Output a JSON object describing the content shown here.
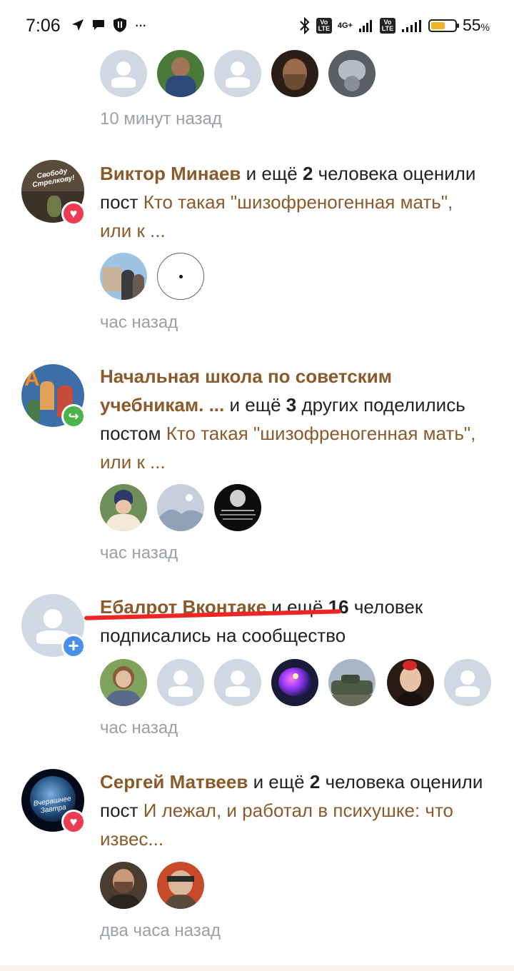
{
  "status_bar": {
    "time": "7:06",
    "battery_percent_label": "55",
    "percent_sign": "%",
    "battery_level": 0.55,
    "net_label": "4G+",
    "volte_label": "Vo LTE",
    "more_label": "···",
    "icons": [
      "navigation-icon",
      "chat-icon",
      "shield-icon",
      "bluetooth-icon",
      "signal-icon",
      "battery-icon"
    ]
  },
  "top_group": {
    "time_label": "10 минут назад"
  },
  "notifications": [
    {
      "actor": "Виктор Минаев",
      "middle": "и ещё",
      "count": "2",
      "rest": "человека",
      "action": "оценили пост",
      "post_title": "Кто такая \"шизофреногенная мать\", или к ...",
      "badge": "heart-icon",
      "time_label": "час назад"
    },
    {
      "actor": "Начальная школа по советским учебникам. ...",
      "middle": "и ещё",
      "count": "3",
      "rest": "других",
      "action": "поделились постом",
      "post_title": "Кто такая \"шизофреногенная мать\", или к ...",
      "badge": "share-icon",
      "time_label": "час назад"
    },
    {
      "actor": "Ебалрот Вконтаке",
      "middle": "и ещё",
      "count": "16",
      "rest": "человек",
      "action": "подписались на сообщество",
      "badge": "plus-icon",
      "time_label": "час назад"
    },
    {
      "actor": "Сергей Матвеев",
      "middle": "и ещё",
      "count": "2",
      "rest": "человека",
      "action": "оценили пост",
      "post_title": "И лежал, и работал в психушке: что извес...",
      "badge": "heart-icon",
      "time_label": "два часа назад"
    }
  ],
  "avatar_image_text": {
    "viktor": "Свободу Стрелкову!",
    "school": "А",
    "sergey": "Вчерашнее Завтра"
  },
  "badge_glyphs": {
    "heart": "♥",
    "share": "↪",
    "plus": "+"
  },
  "colors": {
    "link": "#8b5a2b",
    "heart": "#ec3b53",
    "share": "#4bb34b",
    "plus": "#4c8fe8",
    "placeholder": "#cfd8e3",
    "underline": "#ee2525"
  }
}
